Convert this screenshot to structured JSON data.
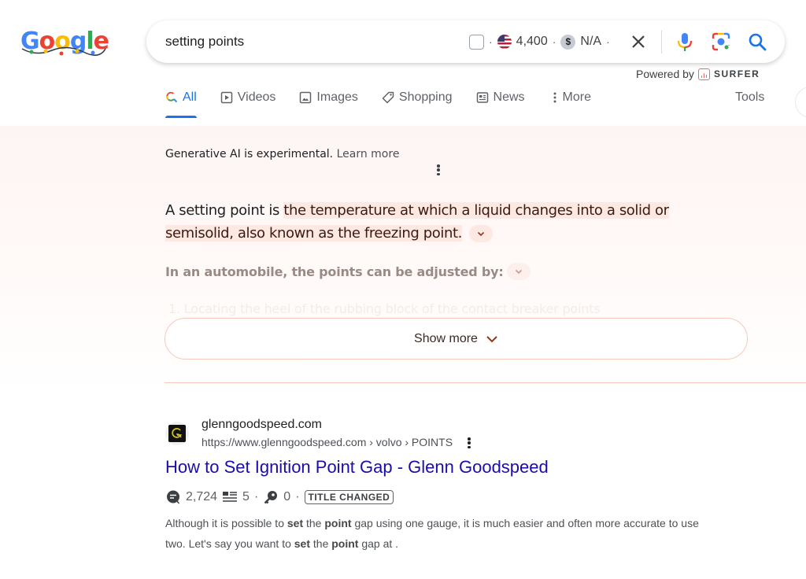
{
  "logo": {
    "letters": [
      "G",
      "o",
      "o",
      "g",
      "l",
      "e"
    ],
    "alt": "Google"
  },
  "search": {
    "query": "setting points",
    "extension": {
      "search_volume": "4,400",
      "cpc": "N/A",
      "dollar_symbol": "$",
      "separator": "·"
    },
    "powered_by_label": "Powered by",
    "powered_by_brand": "SURFER"
  },
  "tabs": [
    {
      "label": "All",
      "icon": "search-icon",
      "active": true
    },
    {
      "label": "Videos",
      "icon": "play-icon",
      "active": false
    },
    {
      "label": "Images",
      "icon": "image-icon",
      "active": false
    },
    {
      "label": "Shopping",
      "icon": "tag-icon",
      "active": false
    },
    {
      "label": "News",
      "icon": "newspaper-icon",
      "active": false
    },
    {
      "label": "More",
      "icon": "more-vert-icon",
      "active": false
    }
  ],
  "tools_label": "Tools",
  "ai_overview": {
    "disclaimer": "Generative AI is experimental.",
    "learn_more": "Learn more",
    "answer_prefix": "A setting point is ",
    "answer_highlight": "the temperature at which a liquid changes into a solid or semisolid, also known as the freezing point.",
    "sub_heading": "In an automobile, the points can be adjusted by:",
    "list_item_1": "1.   Locating the heel of the rubbing block of the contact breaker points",
    "show_more": "Show more"
  },
  "result": {
    "site_name": "glenngoodspeed.com",
    "url": "https://www.glenngoodspeed.com › volvo › POINTS",
    "title": "How to Set Ignition Point Gap - Glenn Goodspeed",
    "metrics": {
      "words": "2,724",
      "headings": "5",
      "keywords": "0",
      "badge": "TITLE CHANGED",
      "separator": "·"
    },
    "snippet": {
      "p1": "Although it is possible to ",
      "b1": "set",
      "p2": " the ",
      "b2": "point",
      "p3": " gap using one gauge, it is much easier and often more accurate to use two. Let's say you want to ",
      "b3": "set",
      "p4": " the ",
      "b4": "point",
      "p5": " gap at ."
    }
  },
  "colors": {
    "accent_blue": "#1a73e8",
    "link_blue": "#1a0dab",
    "ai_highlight": "#fde8e2",
    "ai_border": "#f7c9bb"
  }
}
